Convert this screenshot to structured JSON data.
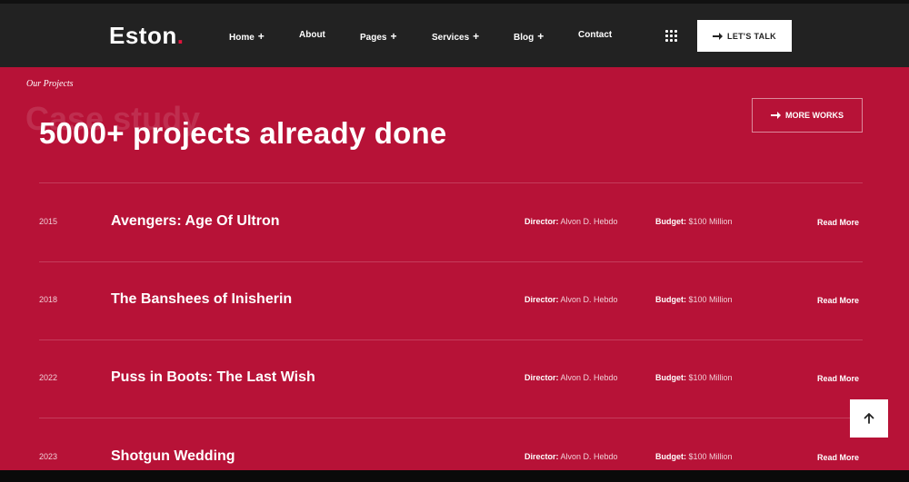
{
  "header": {
    "logo_text": "Eston",
    "logo_dot": ".",
    "nav": [
      {
        "label": "Home",
        "has_submenu": true
      },
      {
        "label": "About",
        "has_submenu": false
      },
      {
        "label": "Pages",
        "has_submenu": true
      },
      {
        "label": "Services",
        "has_submenu": true
      },
      {
        "label": "Blog",
        "has_submenu": true
      },
      {
        "label": "Contact",
        "has_submenu": false
      }
    ],
    "submenu_symbol": "+",
    "grid_icon": "grid-dots-icon",
    "cta_label": "LET'S TALK"
  },
  "section": {
    "subtitle": "Our Projects",
    "ghost_text": "Case study",
    "headline": "5000+ projects already done",
    "more_label": "MORE WORKS"
  },
  "projects": [
    {
      "year": "2015",
      "title": "Avengers: Age Of Ultron",
      "director_label": "Director:",
      "director": "Alvon D. Hebdo",
      "budget_label": "Budget:",
      "budget": "$100 Million",
      "read_more": "Read More"
    },
    {
      "year": "2018",
      "title": "The Banshees of Inisherin",
      "director_label": "Director:",
      "director": "Alvon D. Hebdo",
      "budget_label": "Budget:",
      "budget": "$100 Million",
      "read_more": "Read More"
    },
    {
      "year": "2022",
      "title": "Puss in Boots: The Last Wish",
      "director_label": "Director:",
      "director": "Alvon D. Hebdo",
      "budget_label": "Budget:",
      "budget": "$100 Million",
      "read_more": "Read More"
    },
    {
      "year": "2023",
      "title": "Shotgun Wedding",
      "director_label": "Director:",
      "director": "Alvon D. Hebdo",
      "budget_label": "Budget:",
      "budget": "$100 Million",
      "read_more": "Read More"
    }
  ],
  "colors": {
    "brand": "#b71237",
    "header_bg": "#222222",
    "logo_dot": "#e0143c"
  },
  "scroll_top_icon": "arrow-up-icon"
}
